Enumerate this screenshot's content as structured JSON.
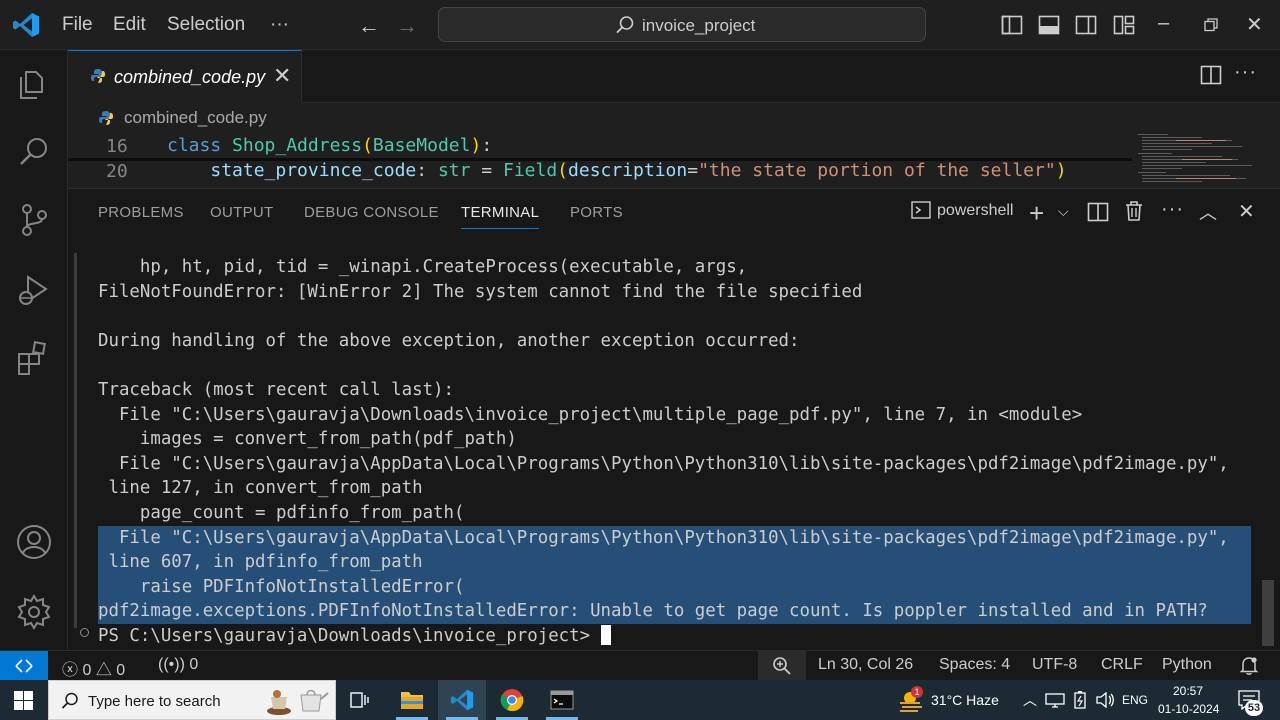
{
  "titlebar": {
    "menus": [
      "File",
      "Edit",
      "Selection",
      "···"
    ],
    "command_center": "invoice_project"
  },
  "editor": {
    "tab_label": "combined_code.py",
    "breadcrumb": "combined_code.py",
    "lines": [
      {
        "num": "16",
        "code": "class Shop_Address(BaseModel):"
      },
      {
        "num": "20",
        "code": "    state_province_code: str = Field(description=\"the state portion of the seller\")"
      }
    ]
  },
  "panel": {
    "tabs": [
      "PROBLEMS",
      "OUTPUT",
      "DEBUG CONSOLE",
      "TERMINAL",
      "PORTS"
    ],
    "active_tab": "TERMINAL",
    "shell": "powershell",
    "terminal_lines": [
      {
        "text": "    hp, ht, pid, tid = _winapi.CreateProcess(executable, args,",
        "selected": false
      },
      {
        "text": "FileNotFoundError: [WinError 2] The system cannot find the file specified",
        "selected": false
      },
      {
        "text": "",
        "selected": false
      },
      {
        "text": "During handling of the above exception, another exception occurred:",
        "selected": false
      },
      {
        "text": "",
        "selected": false
      },
      {
        "text": "Traceback (most recent call last):",
        "selected": false
      },
      {
        "text": "  File \"C:\\Users\\gauravja\\Downloads\\invoice_project\\multiple_page_pdf.py\", line 7, in <module>",
        "selected": false
      },
      {
        "text": "    images = convert_from_path(pdf_path)",
        "selected": false
      },
      {
        "text": "  File \"C:\\Users\\gauravja\\AppData\\Local\\Programs\\Python\\Python310\\lib\\site-packages\\pdf2image\\pdf2image.py\",",
        "selected": false
      },
      {
        "text": " line 127, in convert_from_path",
        "selected": false
      },
      {
        "text": "    page_count = pdfinfo_from_path(",
        "selected": false
      },
      {
        "text": "  File \"C:\\Users\\gauravja\\AppData\\Local\\Programs\\Python\\Python310\\lib\\site-packages\\pdf2image\\pdf2image.py\",",
        "selected": true
      },
      {
        "text": " line 607, in pdfinfo_from_path",
        "selected": true
      },
      {
        "text": "    raise PDFInfoNotInstalledError(",
        "selected": true
      },
      {
        "text": "pdf2image.exceptions.PDFInfoNotInstalledError: Unable to get page count. Is poppler installed and in PATH?",
        "selected": true
      }
    ],
    "prompt": "PS C:\\Users\\gauravja\\Downloads\\invoice_project> "
  },
  "statusbar": {
    "errors": "0",
    "warnings": "0",
    "ports": "0",
    "position": "Ln 30, Col 26",
    "spaces": "Spaces: 4",
    "encoding": "UTF-8",
    "eol": "CRLF",
    "language": "Python"
  },
  "taskbar": {
    "search_placeholder": "Type here to search",
    "weather": "31°C  Haze",
    "weather_badge": "1",
    "lang": "ENG",
    "time": "20:57",
    "date": "01-10-2024",
    "notifications": "53"
  },
  "colors": {
    "accent": "#0078d4",
    "selection": "#264f78",
    "keyword": "#569cd6",
    "class": "#4ec9b0",
    "function": "#dcdcaa",
    "string": "#ce9178",
    "param": "#9cdcfe"
  }
}
